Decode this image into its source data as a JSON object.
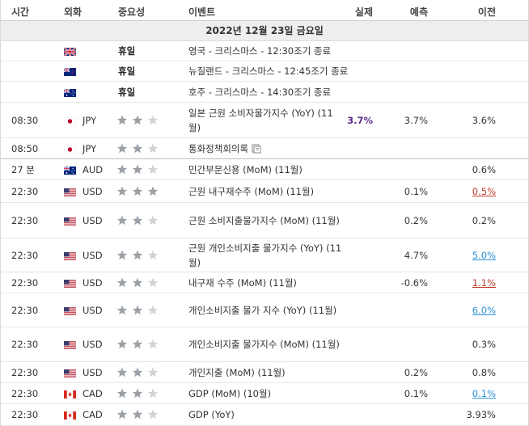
{
  "header": {
    "time": "시간",
    "currency": "외화",
    "importance": "중요성",
    "event": "이벤트",
    "actual": "실제",
    "forecast": "예측",
    "previous": "이전"
  },
  "date_label": "2022년 12월 23일 금요일",
  "rows": [
    {
      "time": "",
      "flag": "flag-uk-icon",
      "currency": "",
      "holiday": "휴일",
      "stars": 0,
      "event": "영국 - 크리스마스 - 12:30조기 종료",
      "actual": "",
      "forecast": "",
      "previous": "",
      "prev_style": ""
    },
    {
      "time": "",
      "flag": "flag-nz-icon",
      "currency": "",
      "holiday": "휴일",
      "stars": 0,
      "event": "뉴질랜드 - 크리스마스 - 12:45조기 종료",
      "actual": "",
      "forecast": "",
      "previous": "",
      "prev_style": ""
    },
    {
      "time": "",
      "flag": "flag-au-icon",
      "currency": "",
      "holiday": "휴일",
      "stars": 0,
      "event": "호주 - 크리스마스 - 14:30조기 종료",
      "actual": "",
      "forecast": "",
      "previous": "",
      "prev_style": ""
    },
    {
      "time": "08:30",
      "flag": "flag-jp-icon",
      "currency": "JPY",
      "holiday": "",
      "stars": 2,
      "event": "일본 근원 소비자물가지수 (YoY) (11월)",
      "actual": "3.7%",
      "forecast": "3.7%",
      "previous": "3.6%",
      "prev_style": ""
    },
    {
      "time": "08:50",
      "flag": "flag-jp-icon",
      "currency": "JPY",
      "holiday": "",
      "stars": 2,
      "event": "통화정책회의록",
      "actual": "",
      "forecast": "",
      "previous": "",
      "prev_style": "",
      "doc": true
    },
    {
      "time": "27 분",
      "flag": "flag-au-icon",
      "currency": "AUD",
      "holiday": "",
      "stars": 2,
      "event": "민간부문신용 (MoM) (11월)",
      "actual": "",
      "forecast": "",
      "previous": "0.6%",
      "prev_style": ""
    },
    {
      "time": "22:30",
      "flag": "flag-us-icon",
      "currency": "USD",
      "holiday": "",
      "stars": 3,
      "event": "근원 내구재수주 (MoM) (11월)",
      "actual": "",
      "forecast": "0.1%",
      "previous": "0.5%",
      "prev_style": "red"
    },
    {
      "time": "22:30",
      "flag": "flag-us-icon",
      "currency": "USD",
      "holiday": "",
      "stars": 2,
      "event": "근원 소비지출물가지수 (MoM) (11월)",
      "actual": "",
      "forecast": "0.2%",
      "previous": "0.2%",
      "prev_style": ""
    },
    {
      "time": "22:30",
      "flag": "flag-us-icon",
      "currency": "USD",
      "holiday": "",
      "stars": 2,
      "event": "근원 개인소비지출 물가지수 (YoY) (11월)",
      "actual": "",
      "forecast": "4.7%",
      "previous": "5.0%",
      "prev_style": "blue"
    },
    {
      "time": "22:30",
      "flag": "flag-us-icon",
      "currency": "USD",
      "holiday": "",
      "stars": 2,
      "event": "내구재 수주 (MoM) (11월)",
      "actual": "",
      "forecast": "-0.6%",
      "previous": "1.1%",
      "prev_style": "red"
    },
    {
      "time": "22:30",
      "flag": "flag-us-icon",
      "currency": "USD",
      "holiday": "",
      "stars": 2,
      "event": "개인소비지출 물가 지수 (YoY) (11월)",
      "actual": "",
      "forecast": "",
      "previous": "6.0%",
      "prev_style": "blue"
    },
    {
      "time": "22:30",
      "flag": "flag-us-icon",
      "currency": "USD",
      "holiday": "",
      "stars": 2,
      "event": "개인소비지출 물가지수 (MoM) (11월)",
      "actual": "",
      "forecast": "",
      "previous": "0.3%",
      "prev_style": ""
    },
    {
      "time": "22:30",
      "flag": "flag-us-icon",
      "currency": "USD",
      "holiday": "",
      "stars": 2,
      "event": "개인지출 (MoM) (11월)",
      "actual": "",
      "forecast": "0.2%",
      "previous": "0.8%",
      "prev_style": ""
    },
    {
      "time": "22:30",
      "flag": "flag-ca-icon",
      "currency": "CAD",
      "holiday": "",
      "stars": 2,
      "event": "GDP (MoM) (10월)",
      "actual": "",
      "forecast": "0.1%",
      "previous": "0.1%",
      "prev_style": "blue"
    },
    {
      "time": "22:30",
      "flag": "flag-ca-icon",
      "currency": "CAD",
      "holiday": "",
      "stars": 2,
      "event": "GDP (YoY)",
      "actual": "",
      "forecast": "",
      "previous": "3.93%",
      "prev_style": ""
    }
  ],
  "colors": {
    "star_on": "#9aa0a6",
    "star_off": "#d0d3d6",
    "actual": "#5b2d8e",
    "prev_red": "#c0392b",
    "prev_blue": "#2b8fd4"
  }
}
